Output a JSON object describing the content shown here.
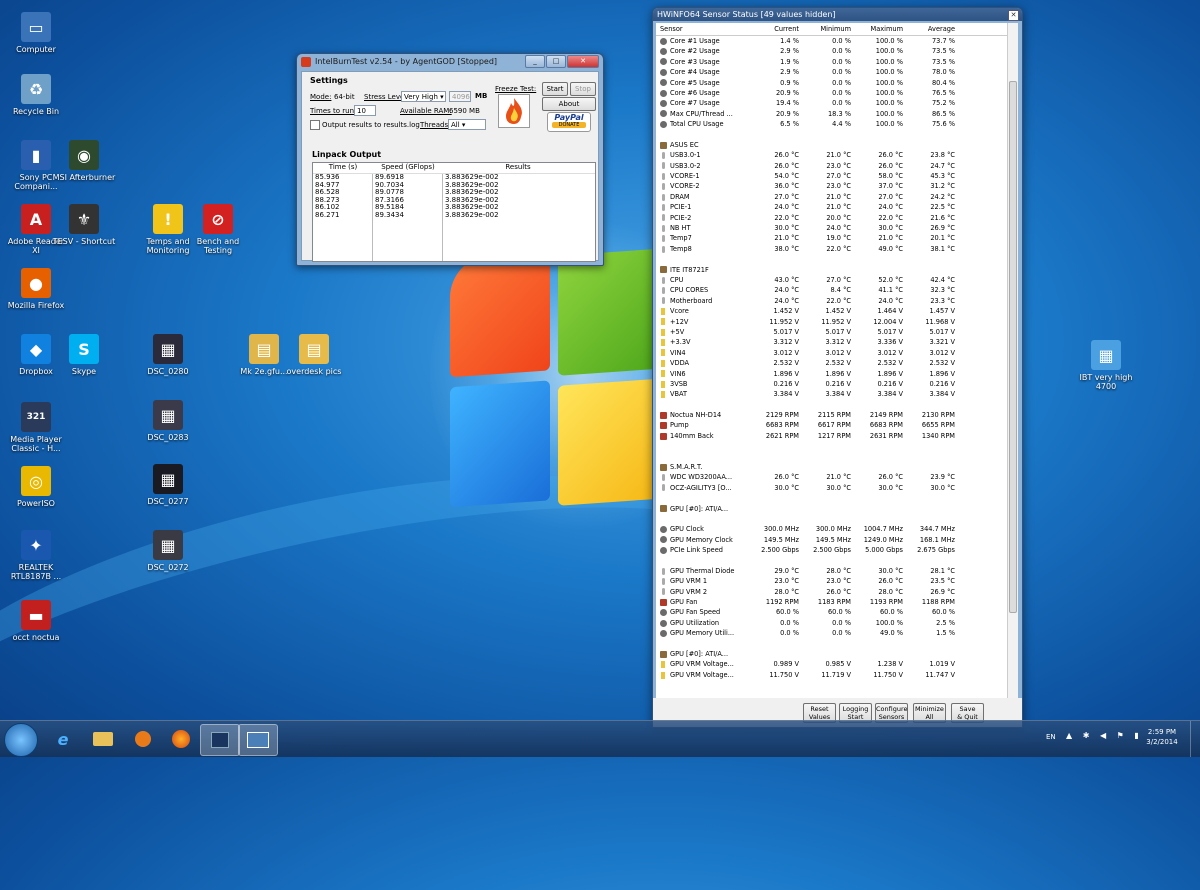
{
  "desktop_icons": [
    {
      "label": "Computer",
      "icon": "computer-icon",
      "color": "#3b73b9"
    },
    {
      "label": "Recycle Bin",
      "icon": "recycle-bin-icon",
      "color": "#6ea0c8"
    },
    {
      "label": "Sony PC Compani...",
      "icon": "sony-pc-companion-icon",
      "color": "#2a5fb0"
    },
    {
      "label": "MSI Afterburner",
      "icon": "msi-afterburner-icon",
      "color": "#2e4a2e"
    },
    {
      "label": "Adobe Reader XI",
      "icon": "adobe-reader-icon",
      "color": "#c8201f"
    },
    {
      "label": "TESV - Shortcut",
      "icon": "skyrim-icon",
      "color": "#333333"
    },
    {
      "label": "Temps and Monitoring",
      "icon": "warning-icon",
      "color": "#f0c419"
    },
    {
      "label": "Bench and Testing",
      "icon": "no-entry-icon",
      "color": "#d32020"
    },
    {
      "label": "Mozilla Firefox",
      "icon": "firefox-icon",
      "color": "#e66000"
    },
    {
      "label": "Dropbox",
      "icon": "dropbox-icon",
      "color": "#1081de"
    },
    {
      "label": "Skype",
      "icon": "skype-icon",
      "color": "#00aff0"
    },
    {
      "label": "DSC_0280",
      "icon": "photo-icon",
      "color": "#2a2a3a"
    },
    {
      "label": "Mk 2e.gfu...",
      "icon": "photo-folder-icon",
      "color": "#e0b64a"
    },
    {
      "label": "overdesk pics",
      "icon": "folder-icon",
      "color": "#e6bb4a"
    },
    {
      "label": "Media Player Classic - H...",
      "icon": "media-player-icon",
      "color": "#2a3a5a"
    },
    {
      "label": "DSC_0283",
      "icon": "photo-icon",
      "color": "#3a3a4a"
    },
    {
      "label": "PowerISO",
      "icon": "poweriso-icon",
      "color": "#e8b900"
    },
    {
      "label": "DSC_0277",
      "icon": "photo-icon",
      "color": "#1a1a22"
    },
    {
      "label": "REALTEK RTL8187B ...",
      "icon": "realtek-icon",
      "color": "#1a58b0"
    },
    {
      "label": "DSC_0272",
      "icon": "photo-icon",
      "color": "#3a3a44"
    },
    {
      "label": "occt noctua",
      "icon": "occt-icon",
      "color": "#c21f1f"
    },
    {
      "label": "IBT very high 4700",
      "icon": "image-file-icon",
      "color": "#4aa0e0"
    }
  ],
  "ibt": {
    "title": "IntelBurnTest v2.54 - by AgentGOD [Stopped]",
    "settings": "Settings",
    "mode_label": "Mode:",
    "mode_value": "64-bit",
    "stress_label": "Stress Level:",
    "stress_value": "Very High",
    "mb_value": "4096",
    "mb_unit": "MB",
    "times_label": "Times to run:",
    "times_value": "10",
    "ram_label": "Available RAM:",
    "ram_value": "6590 MB",
    "output_checkbox": "Output results to results.log",
    "threads_label": "Threads:",
    "threads_value": "All",
    "freeze_label": "Freeze Test:",
    "start": "Start",
    "stop": "Stop",
    "about": "About",
    "paypal": "PayPal",
    "donate": "DONATE",
    "linpack": "Linpack Output",
    "headers": [
      "Time (s)",
      "Speed (GFlops)",
      "Results"
    ],
    "times": [
      "85.936",
      "84.977",
      "86.528",
      "88.273",
      "86.102",
      "86.271"
    ],
    "speeds": [
      "89.6918",
      "90.7034",
      "89.0778",
      "87.3166",
      "89.5184",
      "89.3434"
    ],
    "results": [
      "3.883629e-002",
      "3.883629e-002",
      "3.883629e-002",
      "3.883629e-002",
      "3.883629e-002",
      "3.883629e-002"
    ]
  },
  "hwinfo": {
    "title": "HWiNFO64 Sensor Status [49 values hidden]",
    "columns": [
      "Sensor",
      "Current",
      "Minimum",
      "Maximum",
      "Average"
    ],
    "rows": [
      {
        "t": "r",
        "i": "cpu",
        "n": "Core #1 Usage",
        "v": [
          "1.4 %",
          "0.0 %",
          "100.0 %",
          "73.7 %"
        ]
      },
      {
        "t": "r",
        "i": "cpu",
        "n": "Core #2 Usage",
        "v": [
          "2.9 %",
          "0.0 %",
          "100.0 %",
          "73.5 %"
        ]
      },
      {
        "t": "r",
        "i": "cpu",
        "n": "Core #3 Usage",
        "v": [
          "1.9 %",
          "0.0 %",
          "100.0 %",
          "73.5 %"
        ]
      },
      {
        "t": "r",
        "i": "cpu",
        "n": "Core #4 Usage",
        "v": [
          "2.9 %",
          "0.0 %",
          "100.0 %",
          "78.0 %"
        ]
      },
      {
        "t": "r",
        "i": "cpu",
        "n": "Core #5 Usage",
        "v": [
          "0.9 %",
          "0.0 %",
          "100.0 %",
          "80.4 %"
        ]
      },
      {
        "t": "r",
        "i": "cpu",
        "n": "Core #6 Usage",
        "v": [
          "20.9 %",
          "0.0 %",
          "100.0 %",
          "76.5 %"
        ]
      },
      {
        "t": "r",
        "i": "cpu",
        "n": "Core #7 Usage",
        "v": [
          "19.4 %",
          "0.0 %",
          "100.0 %",
          "75.2 %"
        ]
      },
      {
        "t": "r",
        "i": "cpu",
        "n": "Max CPU/Thread ...",
        "v": [
          "20.9 %",
          "18.3 %",
          "100.0 %",
          "86.5 %"
        ]
      },
      {
        "t": "r",
        "i": "cpu",
        "n": "Total CPU Usage",
        "v": [
          "6.5 %",
          "4.4 %",
          "100.0 %",
          "75.6 %"
        ]
      },
      {
        "t": "e"
      },
      {
        "t": "g",
        "i": "chip",
        "n": "ASUS EC"
      },
      {
        "t": "r",
        "i": "th",
        "n": "USB3.0-1",
        "v": [
          "26.0 °C",
          "21.0 °C",
          "26.0 °C",
          "23.8 °C"
        ]
      },
      {
        "t": "r",
        "i": "th",
        "n": "USB3.0-2",
        "v": [
          "26.0 °C",
          "23.0 °C",
          "26.0 °C",
          "24.7 °C"
        ]
      },
      {
        "t": "r",
        "i": "th",
        "n": "VCORE-1",
        "v": [
          "54.0 °C",
          "27.0 °C",
          "58.0 °C",
          "45.3 °C"
        ]
      },
      {
        "t": "r",
        "i": "th",
        "n": "VCORE-2",
        "v": [
          "36.0 °C",
          "23.0 °C",
          "37.0 °C",
          "31.2 °C"
        ]
      },
      {
        "t": "r",
        "i": "th",
        "n": "DRAM",
        "v": [
          "27.0 °C",
          "21.0 °C",
          "27.0 °C",
          "24.2 °C"
        ]
      },
      {
        "t": "r",
        "i": "th",
        "n": "PCIE-1",
        "v": [
          "24.0 °C",
          "21.0 °C",
          "24.0 °C",
          "22.5 °C"
        ]
      },
      {
        "t": "r",
        "i": "th",
        "n": "PCIE-2",
        "v": [
          "22.0 °C",
          "20.0 °C",
          "22.0 °C",
          "21.6 °C"
        ]
      },
      {
        "t": "r",
        "i": "th",
        "n": "NB HT",
        "v": [
          "30.0 °C",
          "24.0 °C",
          "30.0 °C",
          "26.9 °C"
        ]
      },
      {
        "t": "r",
        "i": "th",
        "n": "Temp7",
        "v": [
          "21.0 °C",
          "19.0 °C",
          "21.0 °C",
          "20.1 °C"
        ]
      },
      {
        "t": "r",
        "i": "th",
        "n": "Temp8",
        "v": [
          "38.0 °C",
          "22.0 °C",
          "49.0 °C",
          "38.1 °C"
        ]
      },
      {
        "t": "e"
      },
      {
        "t": "g",
        "i": "chip",
        "n": "ITE IT8721F"
      },
      {
        "t": "r",
        "i": "th",
        "n": "CPU",
        "v": [
          "43.0 °C",
          "27.0 °C",
          "52.0 °C",
          "42.4 °C"
        ]
      },
      {
        "t": "r",
        "i": "th",
        "n": "CPU CORES",
        "v": [
          "24.0 °C",
          "8.4 °C",
          "41.1 °C",
          "32.3 °C"
        ]
      },
      {
        "t": "r",
        "i": "th",
        "n": "Motherboard",
        "v": [
          "24.0 °C",
          "22.0 °C",
          "24.0 °C",
          "23.3 °C"
        ]
      },
      {
        "t": "r",
        "i": "vl",
        "n": "Vcore",
        "v": [
          "1.452 V",
          "1.452 V",
          "1.464 V",
          "1.457 V"
        ]
      },
      {
        "t": "r",
        "i": "vl",
        "n": "+12V",
        "v": [
          "11.952 V",
          "11.952 V",
          "12.004 V",
          "11.968 V"
        ]
      },
      {
        "t": "r",
        "i": "vl",
        "n": "+5V",
        "v": [
          "5.017 V",
          "5.017 V",
          "5.017 V",
          "5.017 V"
        ]
      },
      {
        "t": "r",
        "i": "vl",
        "n": "+3.3V",
        "v": [
          "3.312 V",
          "3.312 V",
          "3.336 V",
          "3.321 V"
        ]
      },
      {
        "t": "r",
        "i": "vl",
        "n": "VIN4",
        "v": [
          "3.012 V",
          "3.012 V",
          "3.012 V",
          "3.012 V"
        ]
      },
      {
        "t": "r",
        "i": "vl",
        "n": "VDDA",
        "v": [
          "2.532 V",
          "2.532 V",
          "2.532 V",
          "2.532 V"
        ]
      },
      {
        "t": "r",
        "i": "vl",
        "n": "VIN6",
        "v": [
          "1.896 V",
          "1.896 V",
          "1.896 V",
          "1.896 V"
        ]
      },
      {
        "t": "r",
        "i": "vl",
        "n": "3VSB",
        "v": [
          "0.216 V",
          "0.216 V",
          "0.216 V",
          "0.216 V"
        ]
      },
      {
        "t": "r",
        "i": "vl",
        "n": "VBAT",
        "v": [
          "3.384 V",
          "3.384 V",
          "3.384 V",
          "3.384 V"
        ]
      },
      {
        "t": "e"
      },
      {
        "t": "r",
        "i": "fan",
        "n": "Noctua NH-D14",
        "v": [
          "2129 RPM",
          "2115 RPM",
          "2149 RPM",
          "2130 RPM"
        ]
      },
      {
        "t": "r",
        "i": "fan",
        "n": "Pump",
        "v": [
          "6683 RPM",
          "6617 RPM",
          "6683 RPM",
          "6655 RPM"
        ]
      },
      {
        "t": "r",
        "i": "fan",
        "n": "140mm Back",
        "v": [
          "2621 RPM",
          "1217 RPM",
          "2631 RPM",
          "1340 RPM"
        ]
      },
      {
        "t": "e"
      },
      {
        "t": "e"
      },
      {
        "t": "g",
        "i": "chip",
        "n": "S.M.A.R.T."
      },
      {
        "t": "r",
        "i": "th",
        "n": "WDC WD3200AA...",
        "v": [
          "26.0 °C",
          "21.0 °C",
          "26.0 °C",
          "23.9 °C"
        ]
      },
      {
        "t": "r",
        "i": "th",
        "n": "OCZ-AGILITY3 [O...",
        "v": [
          "30.0 °C",
          "30.0 °C",
          "30.0 °C",
          "30.0 °C"
        ]
      },
      {
        "t": "e"
      },
      {
        "t": "g",
        "i": "chip",
        "n": "GPU [#0]: ATI/A..."
      },
      {
        "t": "e"
      },
      {
        "t": "r",
        "i": "cpu",
        "n": "GPU Clock",
        "v": [
          "300.0 MHz",
          "300.0 MHz",
          "1004.7 MHz",
          "344.7 MHz"
        ]
      },
      {
        "t": "r",
        "i": "cpu",
        "n": "GPU Memory Clock",
        "v": [
          "149.5 MHz",
          "149.5 MHz",
          "1249.0 MHz",
          "168.1 MHz"
        ]
      },
      {
        "t": "r",
        "i": "cpu",
        "n": "PCIe Link Speed",
        "v": [
          "2.500 Gbps",
          "2.500 Gbps",
          "5.000 Gbps",
          "2.675 Gbps"
        ]
      },
      {
        "t": "e"
      },
      {
        "t": "r",
        "i": "th",
        "n": "GPU Thermal Diode",
        "v": [
          "29.0 °C",
          "28.0 °C",
          "30.0 °C",
          "28.1 °C"
        ]
      },
      {
        "t": "r",
        "i": "th",
        "n": "GPU VRM 1",
        "v": [
          "23.0 °C",
          "23.0 °C",
          "26.0 °C",
          "23.5 °C"
        ]
      },
      {
        "t": "r",
        "i": "th",
        "n": "GPU VRM 2",
        "v": [
          "28.0 °C",
          "26.0 °C",
          "28.0 °C",
          "26.9 °C"
        ]
      },
      {
        "t": "r",
        "i": "fan",
        "n": "GPU Fan",
        "v": [
          "1192 RPM",
          "1183 RPM",
          "1193 RPM",
          "1188 RPM"
        ]
      },
      {
        "t": "r",
        "i": "cpu",
        "n": "GPU Fan Speed",
        "v": [
          "60.0 %",
          "60.0 %",
          "60.0 %",
          "60.0 %"
        ]
      },
      {
        "t": "r",
        "i": "cpu",
        "n": "GPU Utilization",
        "v": [
          "0.0 %",
          "0.0 %",
          "100.0 %",
          "2.5 %"
        ]
      },
      {
        "t": "r",
        "i": "cpu",
        "n": "GPU Memory Utili...",
        "v": [
          "0.0 %",
          "0.0 %",
          "49.0 %",
          "1.5 %"
        ]
      },
      {
        "t": "e"
      },
      {
        "t": "g",
        "i": "chip",
        "n": "GPU [#0]: ATI/A..."
      },
      {
        "t": "r",
        "i": "vl",
        "n": "GPU VRM Voltage...",
        "v": [
          "0.989 V",
          "0.985 V",
          "1.238 V",
          "1.019 V"
        ]
      },
      {
        "t": "r",
        "i": "vl",
        "n": "GPU VRM Voltage...",
        "v": [
          "11.750 V",
          "11.719 V",
          "11.750 V",
          "11.747 V"
        ]
      }
    ],
    "buttons": [
      [
        "Reset",
        "Values"
      ],
      [
        "Logging",
        "Start"
      ],
      [
        "Configure",
        "Sensors"
      ],
      [
        "Minimize",
        "All"
      ],
      [
        "Save",
        "& Quit"
      ]
    ]
  },
  "taskbar": {
    "lang": "EN",
    "time": "2:59 PM",
    "date": "3/2/2014"
  }
}
